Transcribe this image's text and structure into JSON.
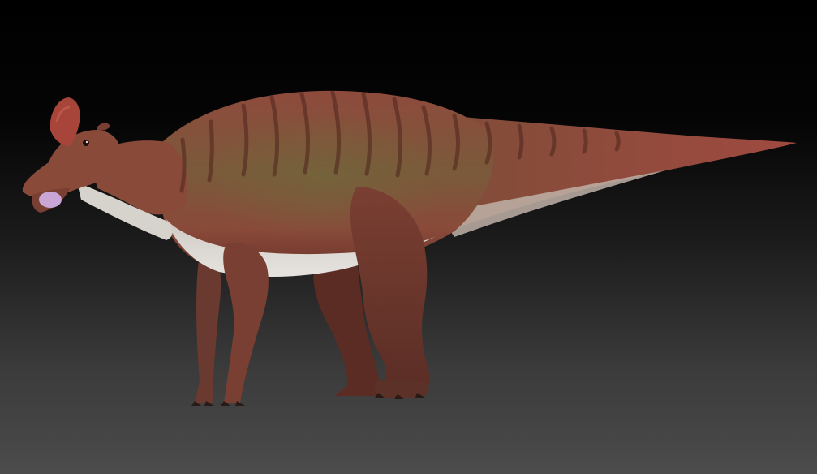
{
  "scene": {
    "subject": "dinosaur-3d-render",
    "background_top_color": "#000000",
    "background_bottom_color": "#4c4c4c",
    "skin_color": "#8a4a3a",
    "skin_dark_color": "#5e2e24",
    "skin_green_tint": "#6f6a3c",
    "belly_color": "#d8d6d2",
    "crest_color": "#a8453a",
    "mouth_color": "#c9a6d6"
  }
}
